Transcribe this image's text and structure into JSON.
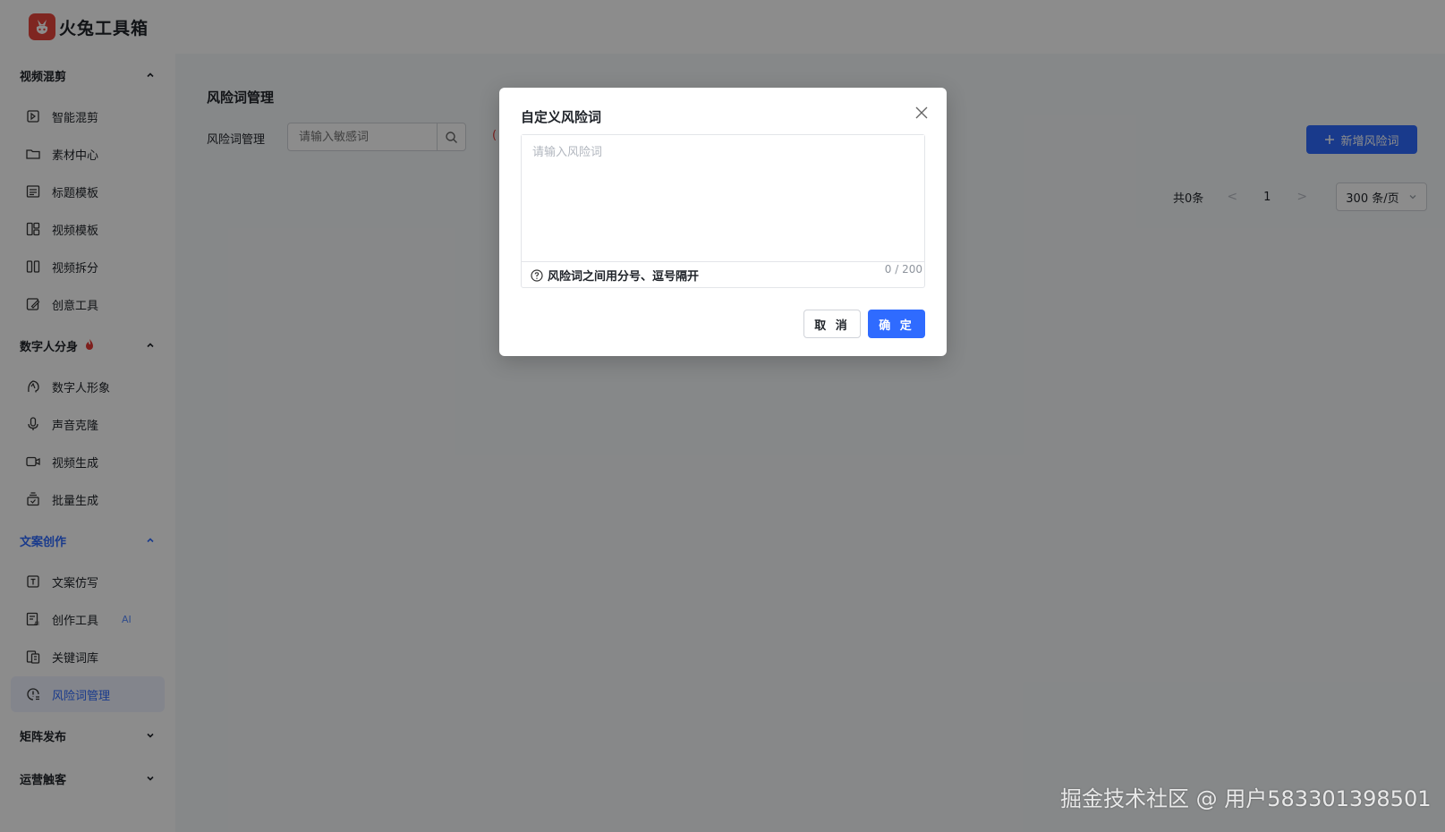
{
  "app": {
    "name": "火兔工具箱"
  },
  "sidebar": {
    "groups": [
      {
        "title": "视频混剪",
        "items": [
          {
            "label": "智能混剪",
            "icon": "smart-mix-icon"
          },
          {
            "label": "素材中心",
            "icon": "folder-icon"
          },
          {
            "label": "标题模板",
            "icon": "title-template-icon"
          },
          {
            "label": "视频模板",
            "icon": "layout-template-icon"
          },
          {
            "label": "视频拆分",
            "icon": "split-icon"
          },
          {
            "label": "创意工具",
            "icon": "creative-tool-icon"
          }
        ]
      },
      {
        "title": "数字人分身",
        "badge": "fire-icon",
        "items": [
          {
            "label": "数字人形象",
            "icon": "avatar-head-icon"
          },
          {
            "label": "声音克隆",
            "icon": "microphone-icon"
          },
          {
            "label": "视频生成",
            "icon": "video-camera-icon"
          },
          {
            "label": "批量生成",
            "icon": "batch-icon"
          }
        ]
      },
      {
        "title": "文案创作",
        "items": [
          {
            "label": "文案仿写",
            "icon": "text-copy-icon"
          },
          {
            "label": "创作工具",
            "icon": "ai-writing-icon",
            "tag": "AI"
          },
          {
            "label": "关键词库",
            "icon": "keyword-library-icon"
          },
          {
            "label": "风险词管理",
            "icon": "risk-word-icon"
          }
        ]
      },
      {
        "title": "矩阵发布"
      },
      {
        "title": "运营触客"
      }
    ]
  },
  "main": {
    "title": "风险词管理",
    "filter_label": "风险词管理",
    "search_placeholder": "请输入敏感词",
    "hint_mark": "(",
    "add_button": "新增风险词",
    "pagination": {
      "total": "共0条",
      "prev": "<",
      "page": "1",
      "next": ">",
      "page_size": "300 条/页"
    }
  },
  "modal": {
    "title": "自定义风险词",
    "placeholder": "请输入风险词",
    "hint": "风险词之间用分号、逗号隔开",
    "count": "0 / 200",
    "cancel": "取 消",
    "confirm": "确 定"
  },
  "watermark": "掘金技术社区 @ 用户583301398501",
  "colors": {
    "accent": "#2f6bff",
    "danger": "#e53935",
    "overlay": "rgba(0,0,0,0.45)"
  }
}
